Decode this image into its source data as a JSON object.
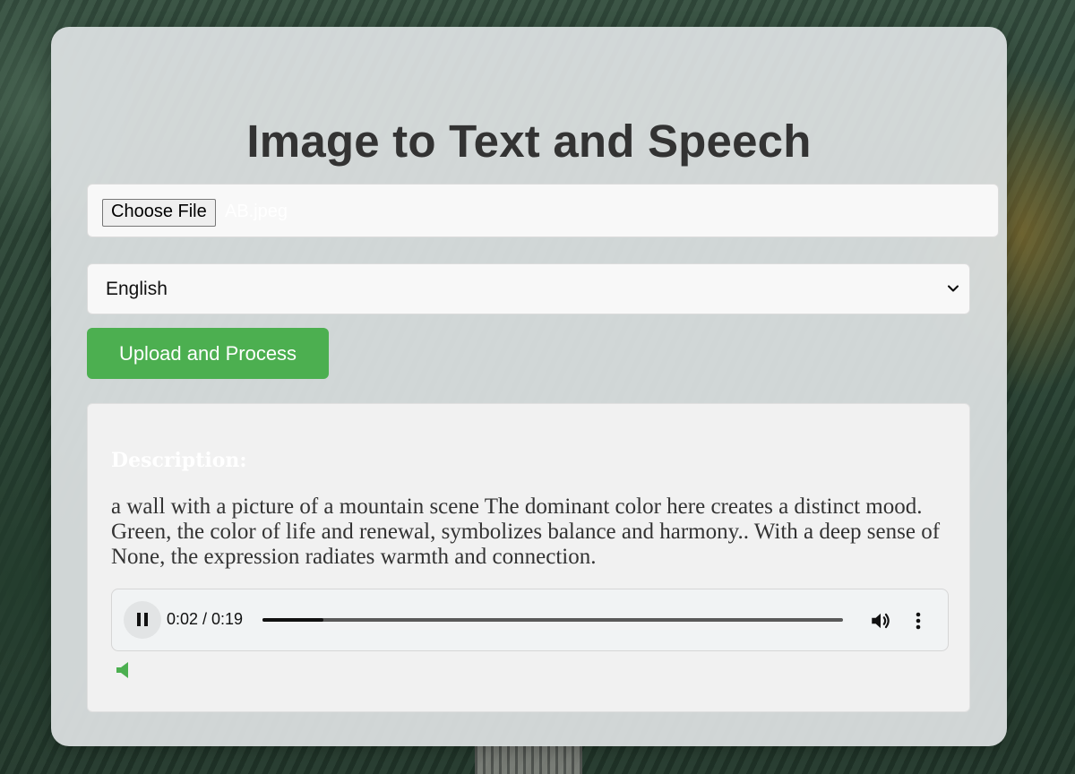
{
  "page": {
    "title": "Image to Text and Speech"
  },
  "file_input": {
    "button_label": "Choose File",
    "file_name": "AB.jpeg"
  },
  "language_select": {
    "selected": "English"
  },
  "upload_button": {
    "label": "Upload and Process"
  },
  "result": {
    "heading": "Description:",
    "text": "a wall with a picture of a mountain scene The dominant color here creates a distinct mood. Green, the color of life and renewal, symbolizes balance and harmony.. With a deep sense of None, the expression radiates warmth and connection."
  },
  "audio_player": {
    "state": "playing",
    "time_display": "0:02 / 0:19",
    "current_seconds": 2,
    "duration_seconds": 19,
    "icons": [
      "pause-icon",
      "volume-icon",
      "more-options-icon"
    ]
  },
  "speaker_icon": {
    "icon": "speaker-icon",
    "color": "#4caf50"
  },
  "colors": {
    "accent": "#4caf50",
    "title": "#333333",
    "card_background": "#dee2e3"
  }
}
